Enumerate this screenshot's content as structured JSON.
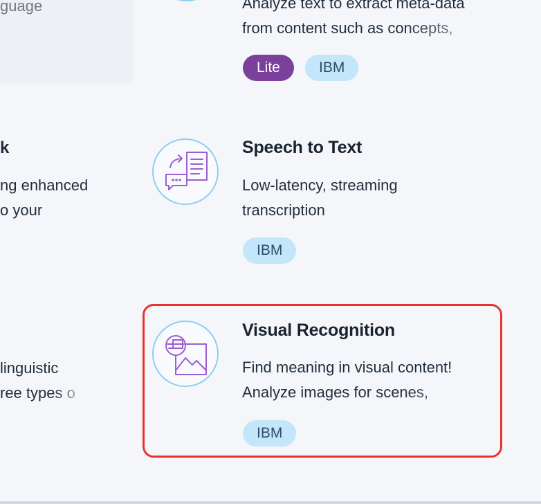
{
  "left_column": {
    "top_fragment": "guage",
    "mid_title_fragment": "k",
    "mid_desc_line1": "ng enhanced",
    "mid_desc_line2": "o your",
    "bottom_desc_line1": "linguistic",
    "bottom_desc_line2": "ree types o"
  },
  "cards": {
    "nlu": {
      "desc_line1": "Analyze text to extract meta-data",
      "desc_line2": "from content such as concepts,",
      "tags": [
        "Lite",
        "IBM"
      ]
    },
    "speech_to_text": {
      "title": "Speech to Text",
      "desc_line1": "Low-latency, streaming",
      "desc_line2": "transcription",
      "tag": "IBM",
      "icon": "speech-to-text-icon"
    },
    "visual_recognition": {
      "title": "Visual Recognition",
      "desc_line1": "Find meaning in visual content!",
      "desc_line2": "Analyze images for scenes,",
      "tag": "IBM",
      "icon": "visual-recognition-icon"
    }
  },
  "colors": {
    "accent_purple": "#7b3f9c",
    "tag_blue": "#c3e6fb",
    "icon_ring": "#8fcff0",
    "icon_stroke": "#9b5fd0",
    "highlight_red": "#e8332d"
  }
}
